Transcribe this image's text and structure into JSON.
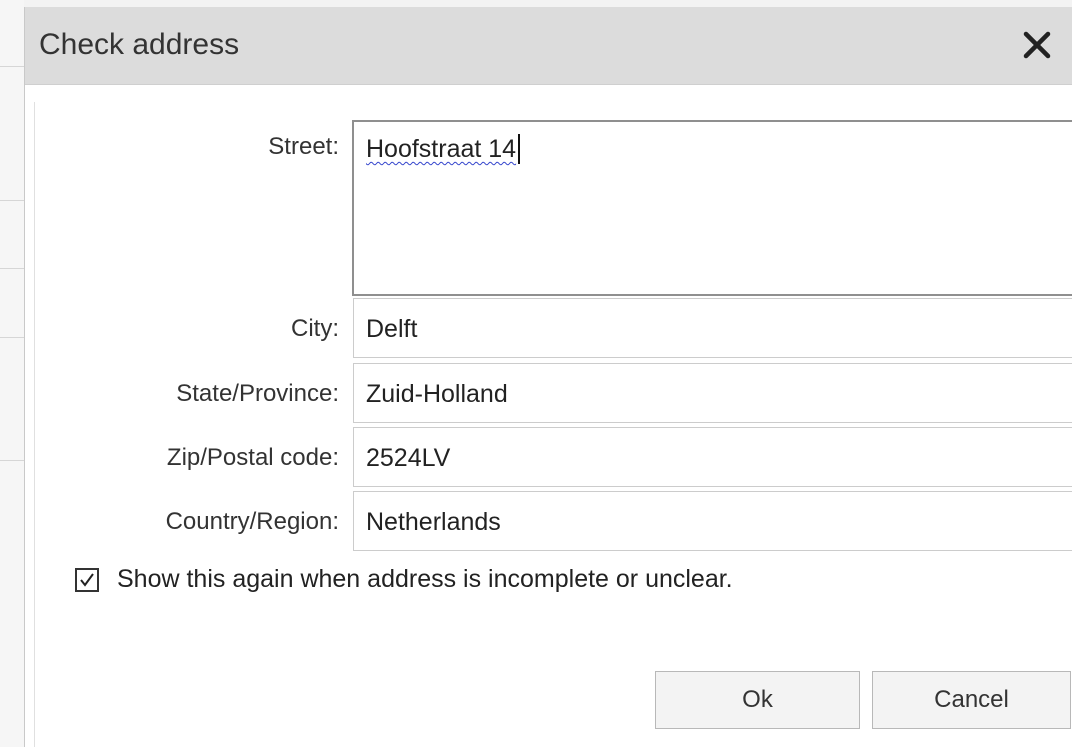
{
  "dialog": {
    "title": "Check address",
    "close_icon": "close-icon"
  },
  "form": {
    "street": {
      "label": "Street:",
      "value": "Hoofstraat 14"
    },
    "city": {
      "label": "City:",
      "value": "Delft"
    },
    "state": {
      "label": "State/Province:",
      "value": "Zuid-Holland"
    },
    "zip": {
      "label": "Zip/Postal code:",
      "value": "2524LV"
    },
    "country": {
      "label": "Country/Region:",
      "value": "Netherlands"
    }
  },
  "options": {
    "show_again": {
      "checked": true,
      "label": "Show this again when address is incomplete or unclear."
    }
  },
  "buttons": {
    "ok_label": "Ok",
    "cancel_label": "Cancel"
  },
  "colors": {
    "titlebar": "#dcdcdc",
    "spellcheck_underline": "#3344cc"
  }
}
